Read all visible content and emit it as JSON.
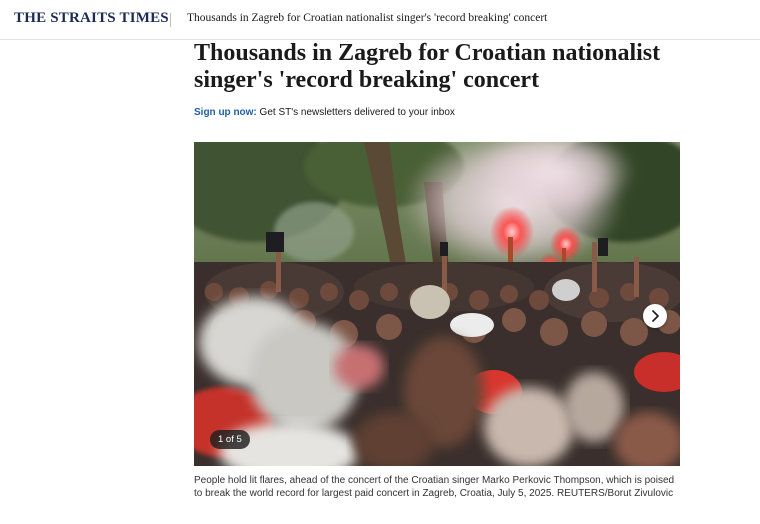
{
  "header": {
    "logo_text": "THE STRAITS TIMES",
    "article_title": "Thousands in Zagreb for Croatian nationalist singer's 'record breaking' concert"
  },
  "article": {
    "headline": "Thousands in Zagreb for Croatian nationalist singer's 'record breaking' concert",
    "signup_link": "Sign up now:",
    "signup_text": " Get ST's newsletters delivered to your inbox"
  },
  "gallery": {
    "counter": "1 of 5",
    "next_icon": "chevron-right-icon",
    "caption": "People hold lit flares, ahead of the concert of the Croatian singer Marko Perkovic Thompson, which is poised to break the world record for largest paid concert in Zagreb, Croatia, July 5, 2025. REUTERS/Borut Zivulovic"
  },
  "colors": {
    "logo": "#1c2a56",
    "link": "#1d5fa8",
    "flare": "#ff3b3b"
  }
}
